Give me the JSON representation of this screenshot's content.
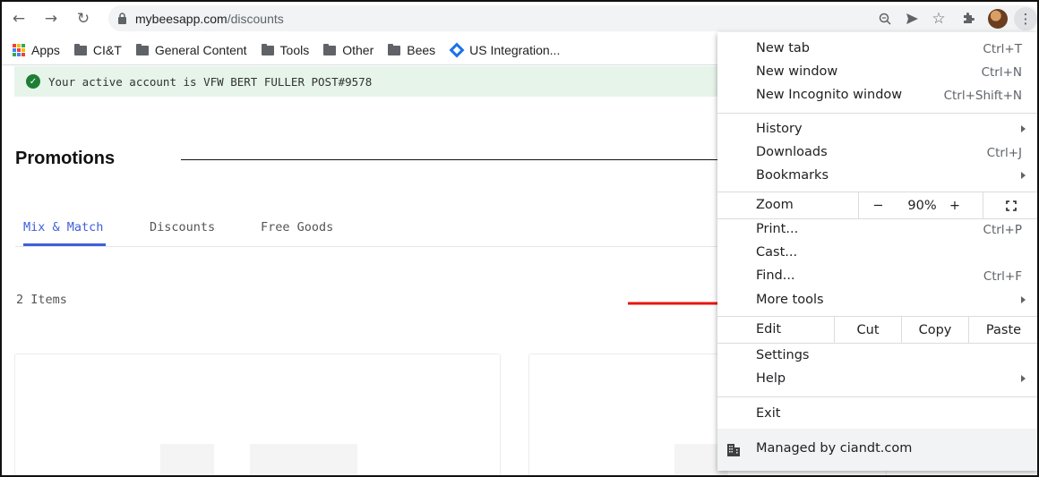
{
  "browser": {
    "url_domain": "mybeesapp.com",
    "url_path": "/discounts",
    "back_icon": "back-arrow-icon",
    "forward_icon": "forward-arrow-icon",
    "reload_icon": "reload-icon"
  },
  "bookmarks": [
    {
      "label": "Apps",
      "icon": "apps-grid-icon"
    },
    {
      "label": "CI&T",
      "icon": "folder-icon"
    },
    {
      "label": "General Content",
      "icon": "folder-icon"
    },
    {
      "label": "Tools",
      "icon": "folder-icon"
    },
    {
      "label": "Other",
      "icon": "folder-icon"
    },
    {
      "label": "Bees",
      "icon": "folder-icon"
    },
    {
      "label": "US Integration...",
      "icon": "jira-diamond-icon"
    }
  ],
  "page": {
    "alert_text": "Your active account is VFW BERT FULLER POST#9578",
    "title": "Promotions",
    "tabs": [
      "Mix & Match",
      "Discounts",
      "Free Goods"
    ],
    "active_tab": "Mix & Match",
    "items_count": "2 Items"
  },
  "menu": {
    "new_tab": {
      "label": "New tab",
      "shortcut": "Ctrl+T"
    },
    "new_window": {
      "label": "New window",
      "shortcut": "Ctrl+N"
    },
    "new_incognito": {
      "label": "New Incognito window",
      "shortcut": "Ctrl+Shift+N"
    },
    "history": {
      "label": "History"
    },
    "downloads": {
      "label": "Downloads",
      "shortcut": "Ctrl+J"
    },
    "bookmarks": {
      "label": "Bookmarks"
    },
    "zoom": {
      "label": "Zoom",
      "minus": "−",
      "value": "90%",
      "plus": "+"
    },
    "print": {
      "label": "Print...",
      "shortcut": "Ctrl+P"
    },
    "cast": {
      "label": "Cast..."
    },
    "find": {
      "label": "Find...",
      "shortcut": "Ctrl+F"
    },
    "more_tools": {
      "label": "More tools"
    },
    "edit": {
      "label": "Edit",
      "cut": "Cut",
      "copy": "Copy",
      "paste": "Paste"
    },
    "settings": {
      "label": "Settings"
    },
    "help": {
      "label": "Help"
    },
    "exit": {
      "label": "Exit"
    },
    "managed": {
      "label": "Managed by ciandt.com"
    }
  },
  "colors": {
    "accent_blue": "#3f5fd9",
    "alert_bg": "#e6f4ea",
    "alert_check": "#1e7e34",
    "arrow_red": "#e8150e"
  }
}
